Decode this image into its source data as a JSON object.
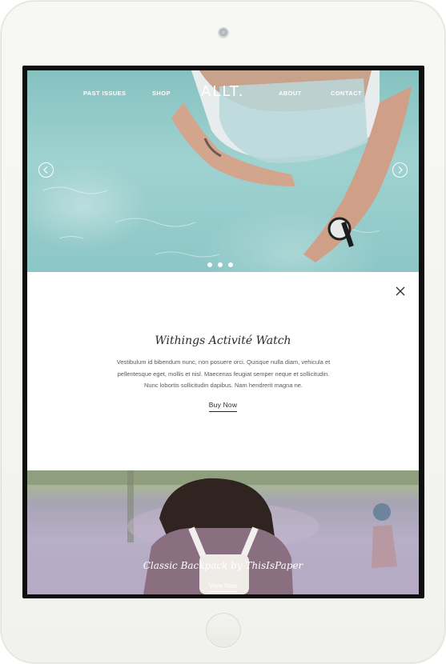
{
  "nav": {
    "past_issues": "PAST ISSUES",
    "shop": "SHOP",
    "logo": "ALLT.",
    "about": "ABOUT",
    "contact": "CONTACT"
  },
  "slider": {
    "prev_icon": "chevron-left-icon",
    "next_icon": "chevron-right-icon",
    "dot_count": 3
  },
  "product": {
    "title": "Withings Activité Watch",
    "description_lines": [
      "Vestibulum id bibendum nunc, non posuere orci. Quisque nulla diam, vehicula et",
      "pellentesque eget, mollis et nisl. Maecenas feugiat semper neque et sollicitudin.",
      "Nunc lobortis sollicitudin dapibus. Nam hendrerit magna ne."
    ],
    "buy_label": "Buy Now",
    "close_icon": "close-icon"
  },
  "next_product": {
    "title": "Classic Backpack by ThisIsPaper",
    "link_label": "View Now"
  },
  "colors": {
    "text_dark": "#2b2b2b",
    "text_body": "#5a5a5a",
    "hero_water": "#9fd2d0",
    "device_body": "#f3f3ef"
  }
}
